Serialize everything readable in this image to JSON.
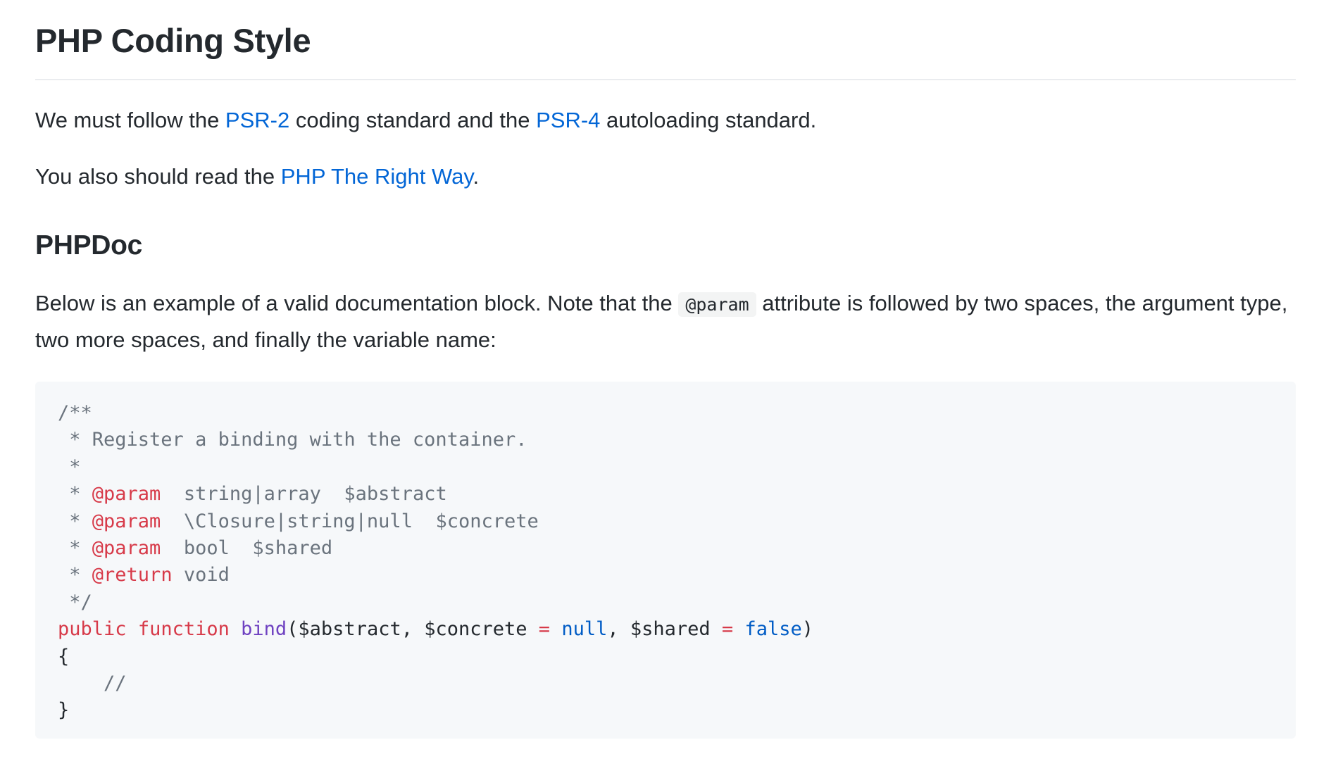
{
  "title": "PHP Coding Style",
  "para1": {
    "t1": "We must follow the ",
    "link1": "PSR-2",
    "t2": " coding standard and the ",
    "link2": "PSR-4",
    "t3": " autoloading standard."
  },
  "para2": {
    "t1": "You also should read the ",
    "link": "PHP The Right Way",
    "t2": "."
  },
  "section_heading": "PHPDoc",
  "para3": {
    "t1": "Below is an example of a valid documentation block. Note that the ",
    "code": "@param",
    "t2": " attribute is followed by two spaces, the argument type, two more spaces, and finally the variable name:"
  },
  "code_block": {
    "l1": "/**",
    "l2": " * Register a binding with the container.",
    "l3": " *",
    "l4_pre": " * ",
    "l4_tag": "@param",
    "l4_rest": "  string|array  $abstract",
    "l5_pre": " * ",
    "l5_tag": "@param",
    "l5_rest": "  \\Closure|string|null  $concrete",
    "l6_pre": " * ",
    "l6_tag": "@param",
    "l6_rest": "  bool  $shared",
    "l7_pre": " * ",
    "l7_tag": "@return",
    "l7_rest": " void",
    "l8": " */",
    "l9_kw1": "public",
    "l9_sp1": " ",
    "l9_kw2": "function",
    "l9_sp2": " ",
    "l9_fn": "bind",
    "l9_a": "($abstract, $concrete ",
    "l9_op1": "=",
    "l9_sp3": " ",
    "l9_null": "null",
    "l9_b": ", $shared ",
    "l9_op2": "=",
    "l9_sp4": " ",
    "l9_false": "false",
    "l9_c": ")",
    "l10": "{",
    "l11": "    //",
    "l12": "}"
  },
  "colors": {
    "link": "#0366d6",
    "text": "#24292e",
    "comment": "#6a737d",
    "keyword": "#d73a49",
    "function": "#6f42c1",
    "constant": "#005cc5",
    "code_bg": "#f6f8fa"
  }
}
